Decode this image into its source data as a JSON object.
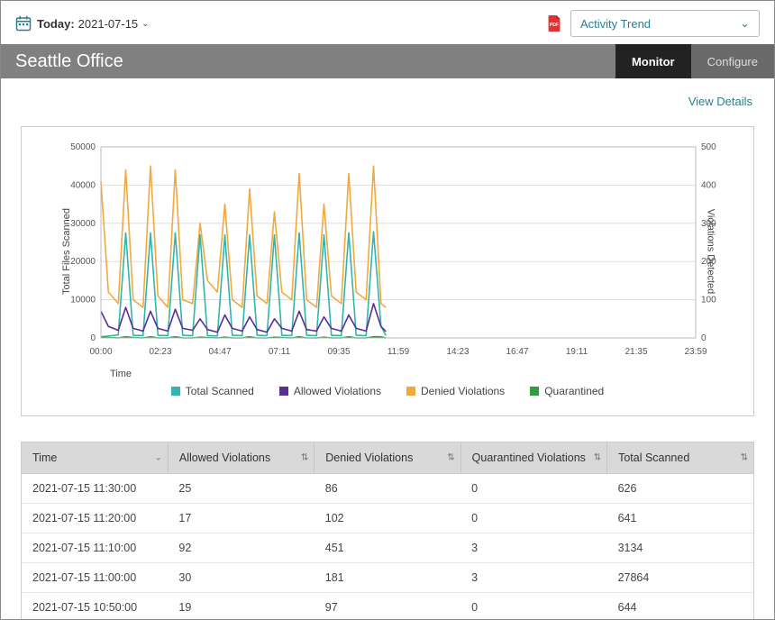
{
  "topbar": {
    "today_label": "Today:",
    "today_date": "2021-07-15",
    "activity_select_label": "Activity Trend"
  },
  "header": {
    "title": "Seattle Office",
    "tab_monitor": "Monitor",
    "tab_configure": "Configure"
  },
  "links": {
    "view_details": "View Details"
  },
  "chart": {
    "ylabel_left": "Total Files Scanned",
    "ylabel_right": "Violations Detected",
    "xlabel": "Time"
  },
  "legend": {
    "total_scanned": "Total Scanned",
    "allowed": "Allowed Violations",
    "denied": "Denied Violations",
    "quarantined": "Quarantined"
  },
  "chart_data": {
    "type": "line",
    "xlabel": "Time",
    "x_ticks": [
      "00:00",
      "02:23",
      "04:47",
      "07:11",
      "09:35",
      "11:59",
      "14:23",
      "16:47",
      "19:11",
      "21:35",
      "23:59"
    ],
    "y_left": {
      "label": "Total Files Scanned",
      "ticks": [
        0,
        10000,
        20000,
        30000,
        40000,
        50000
      ],
      "ylim": [
        0,
        50000
      ]
    },
    "y_right": {
      "label": "Violations Detected",
      "ticks": [
        0,
        100,
        200,
        300,
        400,
        500
      ],
      "ylim": [
        0,
        500
      ]
    },
    "legend": [
      "Total Scanned",
      "Allowed Violations",
      "Denied Violations",
      "Quarantined"
    ],
    "legend_colors": {
      "Total Scanned": "#30b5b0",
      "Allowed Violations": "#5b2f91",
      "Denied Violations": "#f2a93b",
      "Quarantined": "#2e9e3f"
    },
    "note": "Data visible only up to approx 11:30; remaining x-range empty. Values estimated from chart.",
    "series": [
      {
        "name": "Denied Violations",
        "axis": "right",
        "color": "#f2a93b",
        "x": [
          0,
          0.3,
          0.7,
          1.0,
          1.3,
          1.7,
          2.0,
          2.3,
          2.7,
          3.0,
          3.3,
          3.7,
          4.0,
          4.3,
          4.7,
          5.0,
          5.3,
          5.7,
          6.0,
          6.3,
          6.7,
          7.0,
          7.3,
          7.7,
          8.0,
          8.3,
          8.7,
          9.0,
          9.3,
          9.7,
          10.0,
          10.3,
          10.7,
          11.0,
          11.3,
          11.5
        ],
        "values": [
          410,
          120,
          90,
          440,
          100,
          80,
          450,
          110,
          80,
          440,
          100,
          90,
          300,
          150,
          120,
          350,
          100,
          80,
          390,
          110,
          90,
          330,
          120,
          100,
          430,
          100,
          80,
          350,
          110,
          90,
          430,
          120,
          100,
          450,
          90,
          80
        ]
      },
      {
        "name": "Total Scanned",
        "axis": "left",
        "color": "#30b5b0",
        "x": [
          0,
          0.3,
          0.7,
          1.0,
          1.3,
          1.7,
          2.0,
          2.3,
          2.7,
          3.0,
          3.3,
          3.7,
          4.0,
          4.3,
          4.7,
          5.0,
          5.3,
          5.7,
          6.0,
          6.3,
          6.7,
          7.0,
          7.3,
          7.7,
          8.0,
          8.3,
          8.7,
          9.0,
          9.3,
          9.7,
          10.0,
          10.3,
          10.7,
          11.0,
          11.3,
          11.5
        ],
        "values": [
          300,
          500,
          800,
          27500,
          700,
          600,
          27500,
          700,
          600,
          27500,
          700,
          600,
          27000,
          600,
          500,
          27000,
          700,
          600,
          27000,
          700,
          600,
          27000,
          700,
          600,
          27500,
          700,
          600,
          27000,
          700,
          600,
          27500,
          700,
          600,
          27800,
          3100,
          600
        ]
      },
      {
        "name": "Allowed Violations",
        "axis": "right",
        "color": "#5b2f91",
        "x": [
          0,
          0.3,
          0.7,
          1.0,
          1.3,
          1.7,
          2.0,
          2.3,
          2.7,
          3.0,
          3.3,
          3.7,
          4.0,
          4.3,
          4.7,
          5.0,
          5.3,
          5.7,
          6.0,
          6.3,
          6.7,
          7.0,
          7.3,
          7.7,
          8.0,
          8.3,
          8.7,
          9.0,
          9.3,
          9.7,
          10.0,
          10.3,
          10.7,
          11.0,
          11.3,
          11.5
        ],
        "values": [
          70,
          30,
          20,
          80,
          25,
          18,
          70,
          25,
          18,
          75,
          25,
          20,
          50,
          22,
          15,
          60,
          25,
          18,
          55,
          22,
          15,
          50,
          25,
          18,
          70,
          22,
          18,
          55,
          25,
          18,
          60,
          25,
          18,
          90,
          30,
          17
        ]
      },
      {
        "name": "Quarantined",
        "axis": "right",
        "color": "#2e9e3f",
        "x": [
          0,
          0.3,
          0.7,
          1.0,
          1.3,
          1.7,
          2.0,
          2.3,
          2.7,
          3.0,
          3.3,
          3.7,
          4.0,
          4.3,
          4.7,
          5.0,
          5.3,
          5.7,
          6.0,
          6.3,
          6.7,
          7.0,
          7.3,
          7.7,
          8.0,
          8.3,
          8.7,
          9.0,
          9.3,
          9.7,
          10.0,
          10.3,
          10.7,
          11.0,
          11.3,
          11.5
        ],
        "values": [
          2,
          1,
          0,
          3,
          1,
          0,
          3,
          0,
          0,
          3,
          0,
          0,
          2,
          1,
          0,
          2,
          0,
          0,
          3,
          0,
          0,
          2,
          1,
          0,
          3,
          0,
          0,
          2,
          0,
          0,
          3,
          0,
          0,
          3,
          3,
          0
        ]
      }
    ]
  },
  "table": {
    "columns": [
      "Time",
      "Allowed Violations",
      "Denied Violations",
      "Quarantined Violations",
      "Total Scanned"
    ],
    "rows": [
      {
        "time": "2021-07-15 11:30:00",
        "allowed": "25",
        "denied": "86",
        "quarantined": "0",
        "total": "626"
      },
      {
        "time": "2021-07-15 11:20:00",
        "allowed": "17",
        "denied": "102",
        "quarantined": "0",
        "total": "641"
      },
      {
        "time": "2021-07-15 11:10:00",
        "allowed": "92",
        "denied": "451",
        "quarantined": "3",
        "total": "3134"
      },
      {
        "time": "2021-07-15 11:00:00",
        "allowed": "30",
        "denied": "181",
        "quarantined": "3",
        "total": "27864"
      },
      {
        "time": "2021-07-15 10:50:00",
        "allowed": "19",
        "denied": "97",
        "quarantined": "0",
        "total": "644"
      }
    ]
  }
}
